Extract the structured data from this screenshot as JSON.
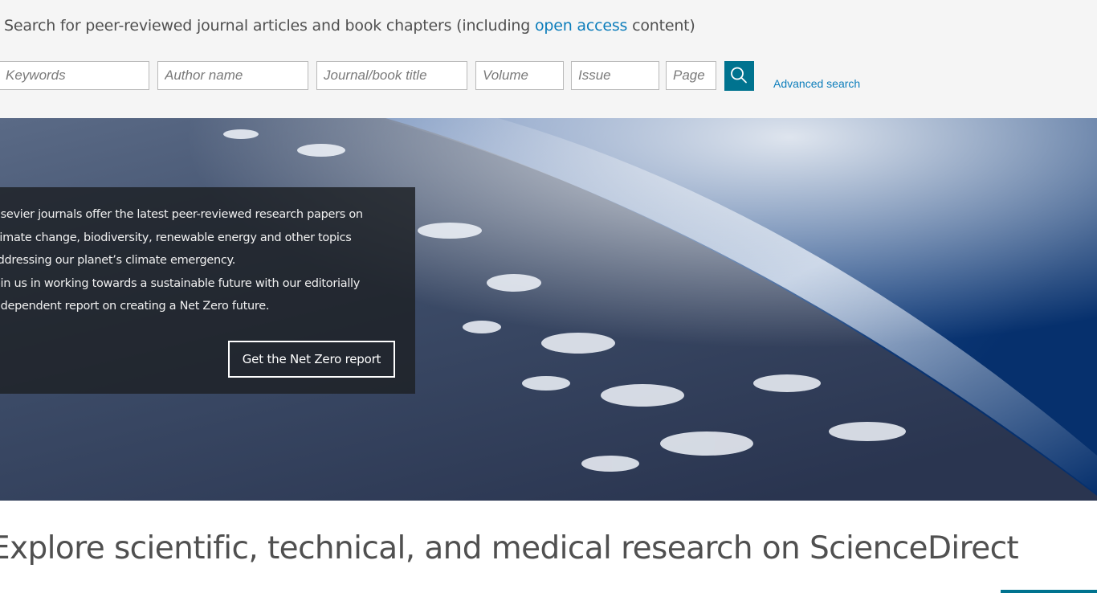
{
  "search": {
    "intro_prefix": "Search for peer-reviewed journal articles and book chapters (including ",
    "intro_link": "open access",
    "intro_suffix": " content)",
    "keywords_placeholder": "Keywords",
    "author_placeholder": "Author name",
    "journal_placeholder": "Journal/book title",
    "volume_placeholder": "Volume",
    "issue_placeholder": "Issue",
    "page_placeholder": "Page",
    "submit_icon": "search-icon",
    "advanced_label": "Advanced search"
  },
  "hero": {
    "lines": [
      "Elsevier journals offer the latest peer-reviewed research papers on",
      "climate change, biodiversity, renewable energy and other topics",
      "addressing our planet’s climate emergency.",
      "Join us in working towards a sustainable future with our editorially",
      "independent report on creating a Net Zero future."
    ],
    "cta_label": "Get the Net Zero report"
  },
  "explore": {
    "heading": "Explore scientific, technical, and medical research on ScienceDirect"
  },
  "colors": {
    "link": "#0c7dbb",
    "accent": "#00738f",
    "search_background": "#f5f5f5"
  }
}
